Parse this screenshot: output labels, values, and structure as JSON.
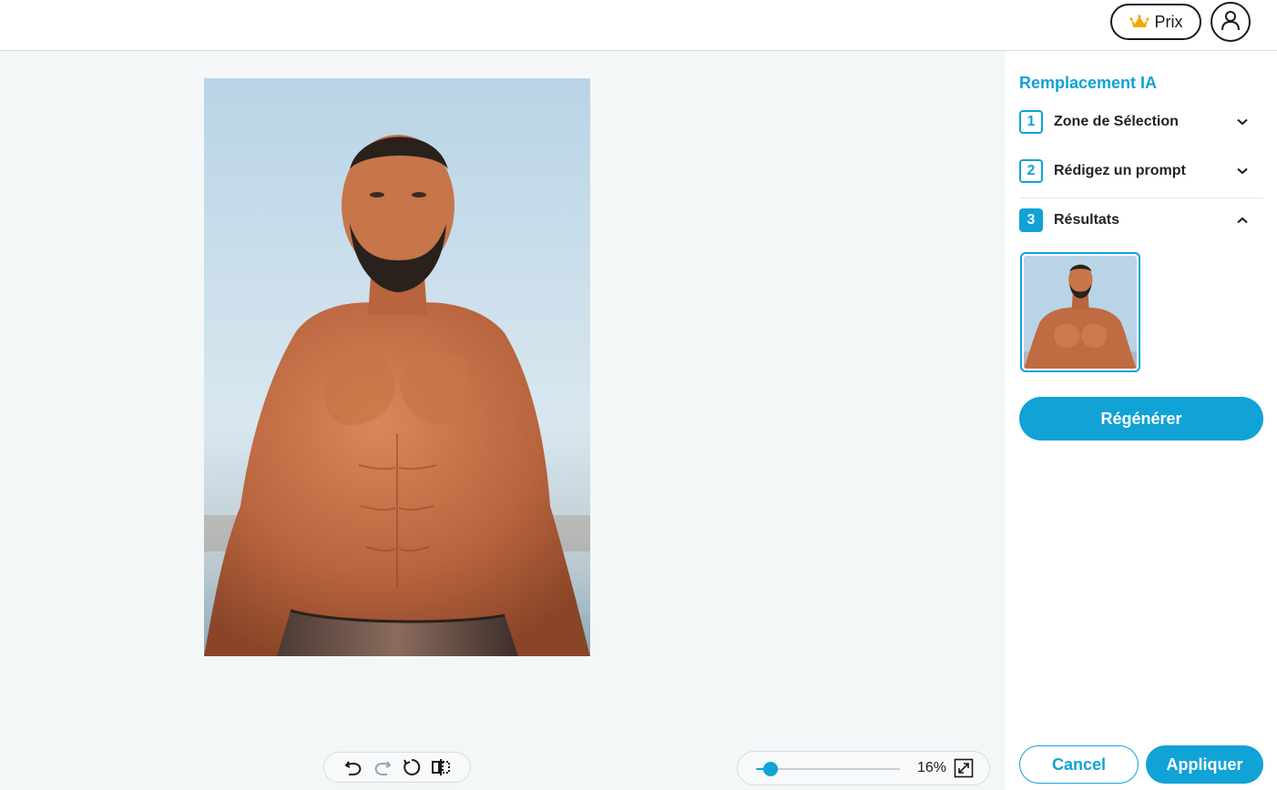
{
  "header": {
    "price_label": "Prix",
    "price_icon": "crown-icon",
    "account_icon": "user-icon"
  },
  "canvas": {
    "image_alt_visible": false
  },
  "toolbar": {
    "tools": [
      "undo-icon",
      "redo-icon",
      "reset-icon",
      "flip-horizontal-icon"
    ]
  },
  "zoom": {
    "value_label": "16%",
    "level_fraction": 0.1,
    "fit_icon": "expand-icon"
  },
  "panel": {
    "title": "Remplacement IA",
    "steps": [
      {
        "number": "1",
        "label": "Zone de Sélection",
        "expanded": false
      },
      {
        "number": "2",
        "label": "Rédigez un prompt",
        "expanded": false
      },
      {
        "number": "3",
        "label": "Résultats",
        "expanded": true
      }
    ],
    "regenerate_label": "Régénérer",
    "cancel_label": "Cancel",
    "apply_label": "Appliquer"
  },
  "colors": {
    "accent": "#11a2d6",
    "canvas_bg": "#f4f7f8",
    "crown": "#f4a900"
  }
}
